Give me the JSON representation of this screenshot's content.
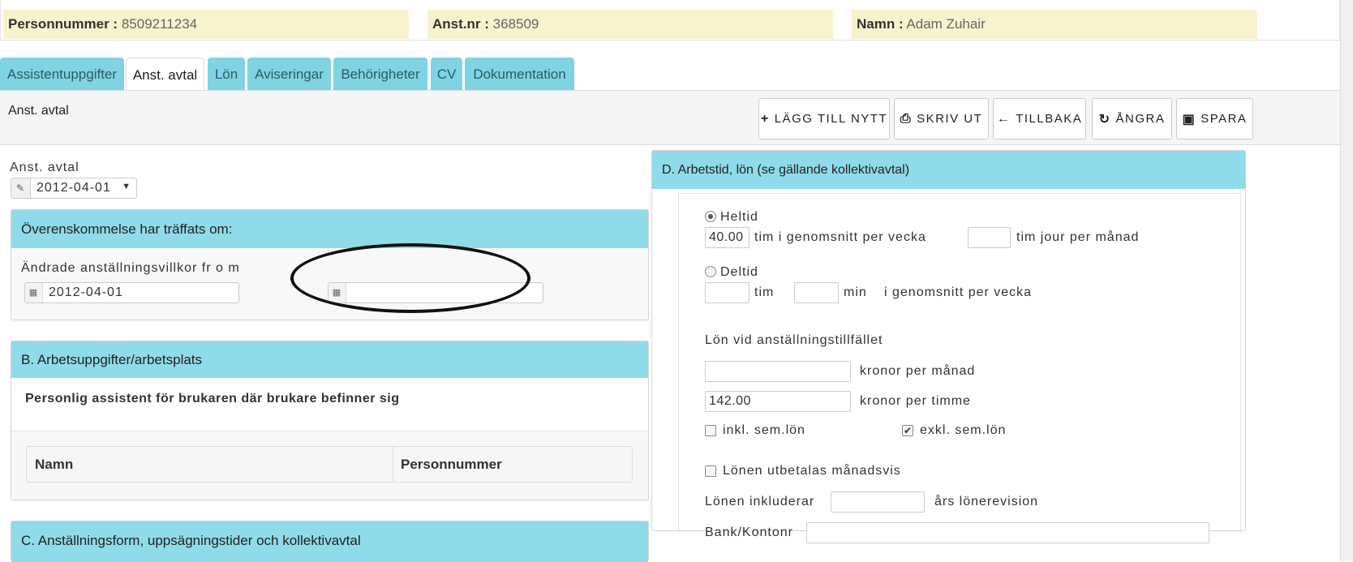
{
  "info": {
    "personnummer_label": "Personnummer :",
    "personnummer": "8509211234",
    "anstnr_label": "Anst.nr :",
    "anstnr": "368509",
    "namn_label": "Namn :",
    "namn": "Adam Zuhair"
  },
  "tabs": [
    "Assistentuppgifter",
    "Anst. avtal",
    "Lön",
    "Aviseringar",
    "Behörigheter",
    "CV",
    "Dokumentation"
  ],
  "header": {
    "title": "Anst. avtal",
    "buttons": [
      "LÄGG TILL NYTT",
      "SKRIV UT",
      "TILLBAKA",
      "ÅNGRA",
      "SPARA"
    ]
  },
  "left": {
    "avtal_label": "Anst. avtal",
    "avtal_selected": "2012-04-01",
    "section_a": {
      "title": "Överenskommelse har träffats om:",
      "field_label": "Ändrade anställningsvillkor fr o m",
      "from_date": "2012-04-01",
      "to_date": ""
    },
    "section_b": {
      "title": "B. Arbetsuppgifter/arbetsplats",
      "description": "Personlig assistent för brukaren där brukare befinner sig",
      "col1": "Namn",
      "col2": "Personnummer"
    },
    "section_c": {
      "title": "C. Anställningsform, uppsägningstider och kollektivavtal"
    }
  },
  "right": {
    "title": "D. Arbetstid, lön (se gällande kollektivavtal)",
    "heltid_label": "Heltid",
    "heltid_hours": "40.00",
    "heltid_suffix": "tim i genomsnitt per vecka",
    "jour_value": "",
    "jour_suffix": "tim jour per månad",
    "deltid_label": "Deltid",
    "deltid_tim_label": "tim",
    "deltid_min_label": "min",
    "deltid_suffix": "i genomsnitt per vecka",
    "lon_label": "Lön vid anställningstillfället",
    "manad_value": "",
    "manad_suffix": "kronor per månad",
    "timme_value": "142.00",
    "timme_suffix": "kronor per timme",
    "inkl_label": "inkl. sem.lön",
    "exkl_label": "exkl. sem.lön",
    "manadsvis_label": "Lönen utbetalas månadsvis",
    "inkluderar_label": "Lönen inkluderar",
    "lonerevision_suffix": "års lönerevision",
    "bank_label": "Bank/Kontonr"
  }
}
